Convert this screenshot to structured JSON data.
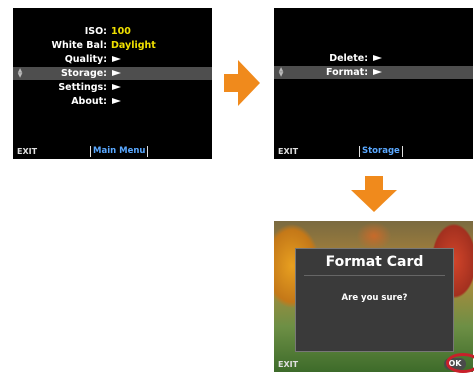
{
  "screen1": {
    "rows": [
      {
        "label": "ISO:",
        "value": "100"
      },
      {
        "label": "White Bal:",
        "value": "Daylight"
      },
      {
        "label": "Quality:"
      },
      {
        "label": "Storage:"
      },
      {
        "label": "Settings:"
      },
      {
        "label": "About:"
      }
    ],
    "exit_label": "EXIT",
    "title": "Main Menu"
  },
  "screen2": {
    "rows": [
      {
        "label": "Delete:"
      },
      {
        "label": "Format:"
      }
    ],
    "exit_label": "EXIT",
    "title": "Storage"
  },
  "screen3": {
    "dialog_title": "Format Card",
    "dialog_message": "Are you sure?",
    "exit_label": "EXIT",
    "ok_label": "OK"
  },
  "colors": {
    "value_yellow": "#f0e000",
    "title_blue": "#5aa8ff",
    "arrow_orange": "#f08a1c",
    "highlight_ring": "#c8202a",
    "selected_row": "#4e4e4e"
  },
  "icons": {
    "flow_arrow_right": "arrow-right-icon",
    "flow_arrow_down": "arrow-down-icon",
    "scroll_indicator": "scroll-updown-icon",
    "submenu_indicator": "triangle-right-icon"
  }
}
